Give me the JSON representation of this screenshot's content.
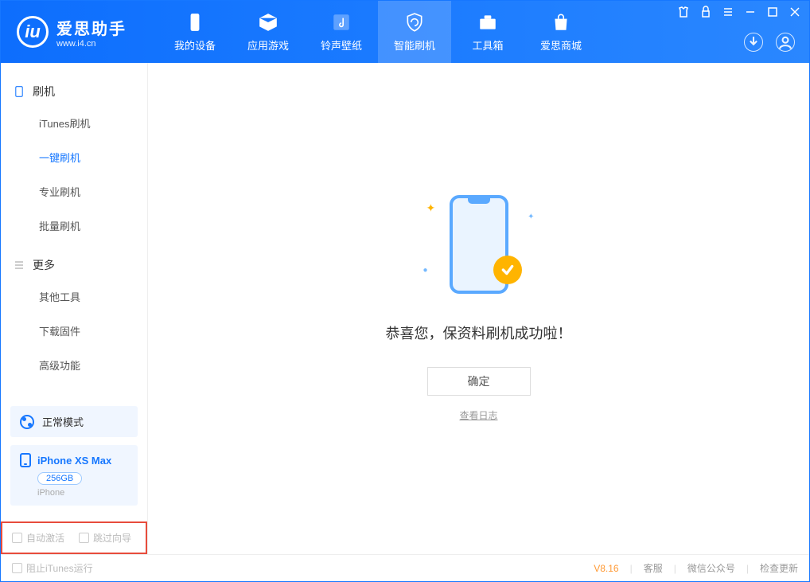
{
  "header": {
    "logo_title": "爱思助手",
    "logo_sub": "www.i4.cn",
    "tabs": [
      {
        "label": "我的设备"
      },
      {
        "label": "应用游戏"
      },
      {
        "label": "铃声壁纸"
      },
      {
        "label": "智能刷机"
      },
      {
        "label": "工具箱"
      },
      {
        "label": "爱思商城"
      }
    ]
  },
  "sidebar": {
    "section1": {
      "title": "刷机",
      "items": [
        "iTunes刷机",
        "一键刷机",
        "专业刷机",
        "批量刷机"
      ]
    },
    "section2": {
      "title": "更多",
      "items": [
        "其他工具",
        "下载固件",
        "高级功能"
      ]
    }
  },
  "device": {
    "mode": "正常模式",
    "name": "iPhone XS Max",
    "storage": "256GB",
    "type": "iPhone"
  },
  "checkboxes": {
    "auto_activate": "自动激活",
    "skip_guide": "跳过向导"
  },
  "main": {
    "title": "恭喜您，保资料刷机成功啦！",
    "ok_button": "确定",
    "log_link": "查看日志"
  },
  "footer": {
    "block_itunes": "阻止iTunes运行",
    "version": "V8.16",
    "links": [
      "客服",
      "微信公众号",
      "检查更新"
    ]
  }
}
